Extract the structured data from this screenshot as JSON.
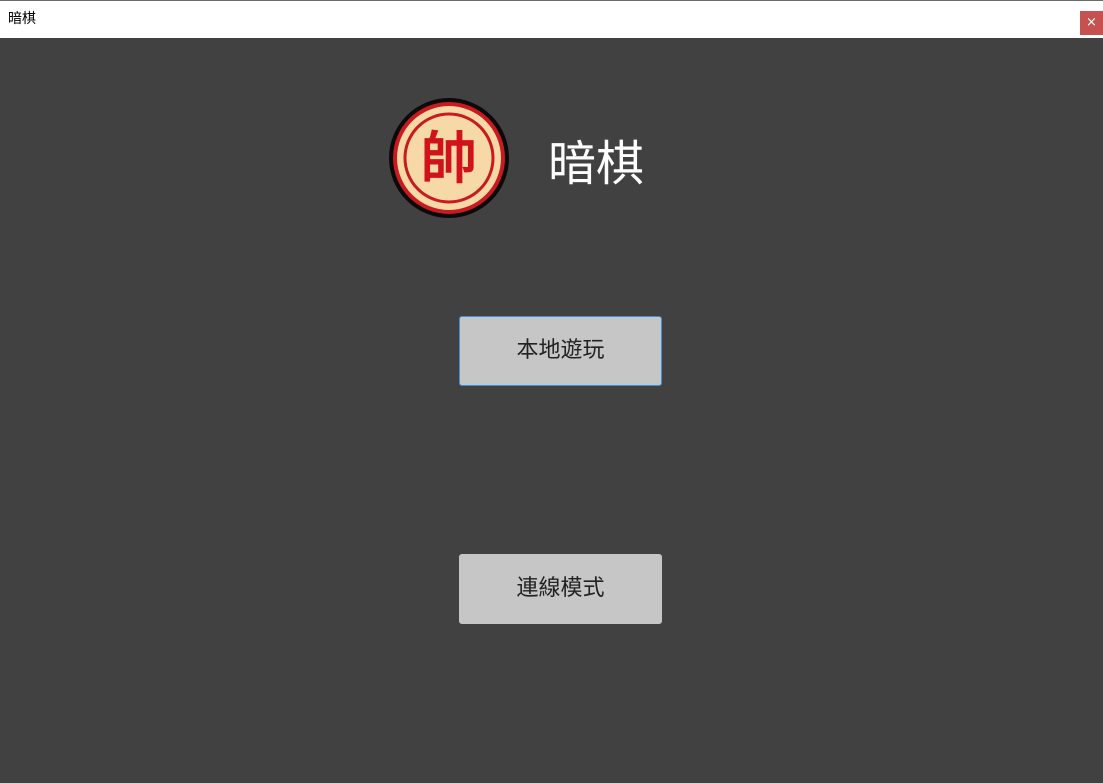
{
  "window": {
    "title": "暗棋",
    "close_label": "×",
    "background_color": "#414141"
  },
  "logo": {
    "icon": "general-piece-icon",
    "piece_char": "帥",
    "piece_fill": "#f7d9a8",
    "piece_color": "#d0121b"
  },
  "header": {
    "title": "暗棋"
  },
  "menu": {
    "local_play_label": "本地遊玩",
    "online_mode_label": "連線模式",
    "button_color": "#c6c6c6",
    "focus_color": "#3c8fd8"
  }
}
